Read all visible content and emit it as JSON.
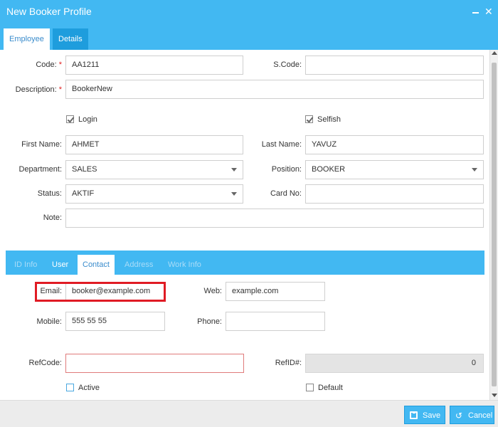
{
  "window": {
    "title": "New Booker Profile"
  },
  "tabs": [
    {
      "label": "Employee",
      "active": true
    },
    {
      "label": "Details",
      "active": false
    }
  ],
  "form": {
    "code": {
      "label": "Code:",
      "value": "AA1211",
      "required": true
    },
    "scode": {
      "label": "S.Code:",
      "value": ""
    },
    "description": {
      "label": "Description:",
      "value": "BookerNew",
      "required": true
    },
    "login": {
      "label": "Login",
      "checked": true
    },
    "selfish": {
      "label": "Selfish",
      "checked": true
    },
    "first_name": {
      "label": "First Name:",
      "value": "AHMET"
    },
    "last_name": {
      "label": "Last Name:",
      "value": "YAVUZ"
    },
    "department": {
      "label": "Department:",
      "value": "SALES"
    },
    "position": {
      "label": "Position:",
      "value": "BOOKER"
    },
    "status": {
      "label": "Status:",
      "value": "AKTIF"
    },
    "card_no": {
      "label": "Card No:",
      "value": ""
    },
    "note": {
      "label": "Note:",
      "value": ""
    }
  },
  "subtabs": [
    {
      "label": "ID Info",
      "enabled": false
    },
    {
      "label": "User",
      "enabled": true
    },
    {
      "label": "Contact",
      "enabled": true,
      "active": true
    },
    {
      "label": "Address",
      "enabled": false
    },
    {
      "label": "Work Info",
      "enabled": false
    }
  ],
  "contact": {
    "email": {
      "label": "Email:",
      "value": "booker@example.com"
    },
    "web": {
      "label": "Web:",
      "value": "example.com"
    },
    "mobile": {
      "label": "Mobile:",
      "value": "555 55 55"
    },
    "phone": {
      "label": "Phone:",
      "value": ""
    }
  },
  "ref": {
    "refcode": {
      "label": "RefCode:",
      "value": ""
    },
    "refid": {
      "label": "RefID#:",
      "value": "0"
    },
    "active": {
      "label": "Active",
      "checked": false
    },
    "default": {
      "label": "Default",
      "checked": false
    }
  },
  "footer": {
    "save_label": "Save",
    "cancel_label": "Cancel"
  },
  "icons": {
    "close": "close-icon",
    "minimize": "minimize-icon",
    "save": "floppy-disk-icon",
    "cancel": "undo-icon"
  },
  "colors": {
    "accent": "#42b8f2",
    "highlight": "#e01b24",
    "required": "#e02020"
  }
}
